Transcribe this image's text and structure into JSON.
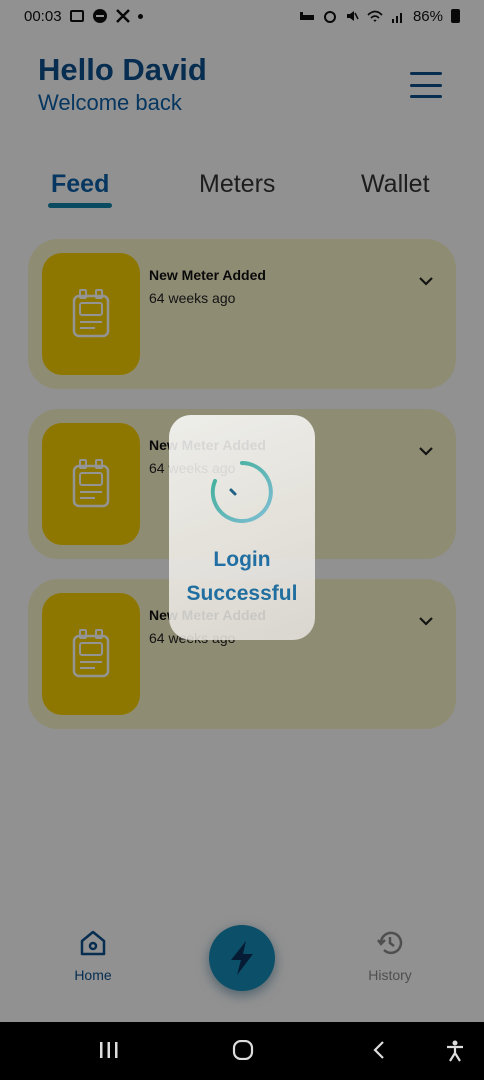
{
  "status_bar": {
    "time": "00:03",
    "battery": "86%"
  },
  "header": {
    "greeting": "Hello David",
    "subtitle": "Welcome back"
  },
  "tabs": [
    {
      "label": "Feed",
      "active": true
    },
    {
      "label": "Meters",
      "active": false
    },
    {
      "label": "Wallet",
      "active": false
    }
  ],
  "feed": [
    {
      "title": "New Meter Added",
      "time": "64 weeks ago",
      "icon": "meter-icon"
    },
    {
      "title": "New Meter Added",
      "time": "64 weeks ago",
      "icon": "meter-icon"
    },
    {
      "title": "New Meter Added",
      "time": "64 weeks ago",
      "icon": "meter-icon"
    }
  ],
  "bottom_nav": {
    "home_label": "Home",
    "history_label": "History",
    "fab_icon": "lightning-icon"
  },
  "dialog": {
    "line1": "Login",
    "line2": "Successful"
  },
  "colors": {
    "primary": "#0d4f8b",
    "accent": "#1688b5",
    "card_bg": "#f7f2c8",
    "thumb_bg": "#f5ce00"
  }
}
